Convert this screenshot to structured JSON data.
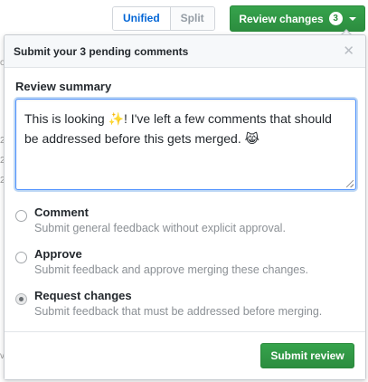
{
  "diff_view": {
    "options": [
      "Unified",
      "Split"
    ],
    "selected": "Unified"
  },
  "review_button": {
    "label": "Review changes",
    "count": "3"
  },
  "background": {
    "fragments": [
      "o",
      "2",
      "2",
      "2",
      "v"
    ]
  },
  "popover": {
    "title": "Submit your 3 pending comments",
    "close_icon": "close-icon",
    "summary_label": "Review summary",
    "summary_text": "This is looking ✨! I've left a few comments that should be addressed before this gets merged. 😹",
    "options": [
      {
        "title": "Comment",
        "description": "Submit general feedback without explicit approval.",
        "checked": false
      },
      {
        "title": "Approve",
        "description": "Submit feedback and approve merging these changes.",
        "checked": false
      },
      {
        "title": "Request changes",
        "description": "Submit feedback that must be addressed before merging.",
        "checked": true
      }
    ],
    "submit_label": "Submit review"
  },
  "colors": {
    "primary_green": "#2c8d3f",
    "link_blue": "#0366d6",
    "focus_border": "#4d90fe"
  }
}
